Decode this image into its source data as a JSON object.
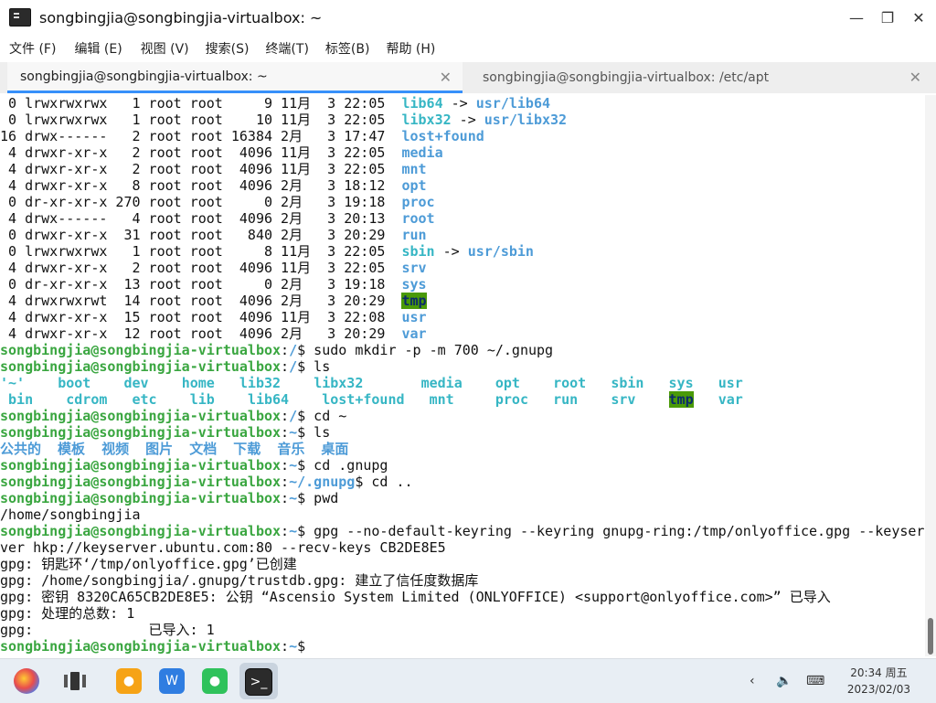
{
  "window": {
    "title": "songbingjia@songbingjia-virtualbox: ~"
  },
  "menu": [
    "文件 (F)",
    "编辑 (E)",
    "视图 (V)",
    "搜索(S)",
    "终端(T)",
    "标签(B)",
    "帮助 (H)"
  ],
  "tabs": [
    {
      "label": "songbingjia@songbingjia-virtualbox: ~"
    },
    {
      "label": "songbingjia@songbingjia-virtualbox: /etc/apt"
    }
  ],
  "terminal": {
    "lines": [
      [
        [
          " 0 lrwxrwxrwx   1 root root     9 11月  3 22:05  ",
          ""
        ],
        [
          "lib64",
          "cyan"
        ],
        [
          " -> ",
          ""
        ],
        [
          "usr/lib64",
          "blue"
        ]
      ],
      [
        [
          " 0 lrwxrwxrwx   1 root root    10 11月  3 22:05  ",
          ""
        ],
        [
          "libx32",
          "cyan"
        ],
        [
          " -> ",
          ""
        ],
        [
          "usr/libx32",
          "blue"
        ]
      ],
      [
        [
          "16 drwx------   2 root root 16384 2月   3 17:47  ",
          ""
        ],
        [
          "lost+found",
          "blue"
        ]
      ],
      [
        [
          " 4 drwxr-xr-x   2 root root  4096 11月  3 22:05  ",
          ""
        ],
        [
          "media",
          "blue"
        ]
      ],
      [
        [
          " 4 drwxr-xr-x   2 root root  4096 11月  3 22:05  ",
          ""
        ],
        [
          "mnt",
          "blue"
        ]
      ],
      [
        [
          " 4 drwxr-xr-x   8 root root  4096 2月   3 18:12  ",
          ""
        ],
        [
          "opt",
          "blue"
        ]
      ],
      [
        [
          " 0 dr-xr-xr-x 270 root root     0 2月   3 19:18  ",
          ""
        ],
        [
          "proc",
          "blue"
        ]
      ],
      [
        [
          " 4 drwx------   4 root root  4096 2月   3 20:13  ",
          ""
        ],
        [
          "root",
          "blue"
        ]
      ],
      [
        [
          " 0 drwxr-xr-x  31 root root   840 2月   3 20:29  ",
          ""
        ],
        [
          "run",
          "blue"
        ]
      ],
      [
        [
          " 0 lrwxrwxrwx   1 root root     8 11月  3 22:05  ",
          ""
        ],
        [
          "sbin",
          "cyan"
        ],
        [
          " -> ",
          ""
        ],
        [
          "usr/sbin",
          "blue"
        ]
      ],
      [
        [
          " 4 drwxr-xr-x   2 root root  4096 11月  3 22:05  ",
          ""
        ],
        [
          "srv",
          "blue"
        ]
      ],
      [
        [
          " 0 dr-xr-xr-x  13 root root     0 2月   3 19:18  ",
          ""
        ],
        [
          "sys",
          "blue"
        ]
      ],
      [
        [
          " 4 drwxrwxrwt  14 root root  4096 2月   3 20:29  ",
          ""
        ],
        [
          "tmp",
          "hl"
        ]
      ],
      [
        [
          " 4 drwxr-xr-x  15 root root  4096 11月  3 22:08  ",
          ""
        ],
        [
          "usr",
          "blue"
        ]
      ],
      [
        [
          " 4 drwxr-xr-x  12 root root  4096 2月   3 20:29  ",
          ""
        ],
        [
          "var",
          "blue"
        ]
      ],
      [
        [
          "songbingjia@songbingjia-virtualbox",
          "green"
        ],
        [
          ":",
          ""
        ],
        [
          "/",
          "blue"
        ],
        [
          "$ sudo mkdir -p -m 700 ~/.gnupg",
          ""
        ]
      ],
      [
        [
          "songbingjia@songbingjia-virtualbox",
          "green"
        ],
        [
          ":",
          ""
        ],
        [
          "/",
          "blue"
        ],
        [
          "$ ls",
          ""
        ]
      ],
      [
        [
          "'~'",
          "cyan"
        ],
        [
          "    ",
          ""
        ],
        [
          "boot",
          "cyan"
        ],
        [
          "    ",
          ""
        ],
        [
          "dev",
          "cyan"
        ],
        [
          "    ",
          ""
        ],
        [
          "home",
          "cyan"
        ],
        [
          "   ",
          ""
        ],
        [
          "lib32",
          "cyan"
        ],
        [
          "    ",
          ""
        ],
        [
          "libx32",
          "cyan"
        ],
        [
          "       ",
          ""
        ],
        [
          "media",
          "cyan"
        ],
        [
          "    ",
          ""
        ],
        [
          "opt",
          "cyan"
        ],
        [
          "    ",
          ""
        ],
        [
          "root",
          "cyan"
        ],
        [
          "   ",
          ""
        ],
        [
          "sbin",
          "cyan"
        ],
        [
          "   ",
          ""
        ],
        [
          "sys",
          "cyan"
        ],
        [
          "   ",
          ""
        ],
        [
          "usr",
          "cyan"
        ]
      ],
      [
        [
          " ",
          ""
        ],
        [
          "bin",
          "cyan"
        ],
        [
          "    ",
          ""
        ],
        [
          "cdrom",
          "cyan"
        ],
        [
          "   ",
          ""
        ],
        [
          "etc",
          "cyan"
        ],
        [
          "    ",
          ""
        ],
        [
          "lib",
          "cyan"
        ],
        [
          "    ",
          ""
        ],
        [
          "lib64",
          "cyan"
        ],
        [
          "    ",
          ""
        ],
        [
          "lost+found",
          "cyan"
        ],
        [
          "   ",
          ""
        ],
        [
          "mnt",
          "cyan"
        ],
        [
          "     ",
          ""
        ],
        [
          "proc",
          "cyan"
        ],
        [
          "   ",
          ""
        ],
        [
          "run",
          "cyan"
        ],
        [
          "    ",
          ""
        ],
        [
          "srv",
          "cyan"
        ],
        [
          "    ",
          ""
        ],
        [
          "tmp",
          "hl"
        ],
        [
          "   ",
          ""
        ],
        [
          "var",
          "cyan"
        ]
      ],
      [
        [
          "songbingjia@songbingjia-virtualbox",
          "green"
        ],
        [
          ":",
          ""
        ],
        [
          "/",
          "blue"
        ],
        [
          "$ cd ~",
          ""
        ]
      ],
      [
        [
          "songbingjia@songbingjia-virtualbox",
          "green"
        ],
        [
          ":",
          ""
        ],
        [
          "~",
          "blue"
        ],
        [
          "$ ls",
          ""
        ]
      ],
      [
        [
          "公共的  模板  视频  图片  文档  下载  音乐  桌面",
          "blue"
        ]
      ],
      [
        [
          "songbingjia@songbingjia-virtualbox",
          "green"
        ],
        [
          ":",
          ""
        ],
        [
          "~",
          "blue"
        ],
        [
          "$ cd .gnupg",
          ""
        ]
      ],
      [
        [
          "songbingjia@songbingjia-virtualbox",
          "green"
        ],
        [
          ":",
          ""
        ],
        [
          "~/.gnupg",
          "blue"
        ],
        [
          "$ cd ..",
          ""
        ]
      ],
      [
        [
          "songbingjia@songbingjia-virtualbox",
          "green"
        ],
        [
          ":",
          ""
        ],
        [
          "~",
          "blue"
        ],
        [
          "$ pwd",
          ""
        ]
      ],
      [
        [
          "/home/songbingjia",
          ""
        ]
      ],
      [
        [
          "songbingjia@songbingjia-virtualbox",
          "green"
        ],
        [
          ":",
          ""
        ],
        [
          "~",
          "blue"
        ],
        [
          "$ gpg --no-default-keyring --keyring gnupg-ring:/tmp/onlyoffice.gpg --keyser",
          ""
        ]
      ],
      [
        [
          "ver hkp://keyserver.ubuntu.com:80 --recv-keys CB2DE8E5",
          ""
        ]
      ],
      [
        [
          "gpg: 钥匙环‘/tmp/onlyoffice.gpg’已创建",
          ""
        ]
      ],
      [
        [
          "gpg: /home/songbingjia/.gnupg/trustdb.gpg: 建立了信任度数据库",
          ""
        ]
      ],
      [
        [
          "gpg: 密钥 8320CA65CB2DE8E5: 公钥 “Ascensio System Limited (ONLYOFFICE) <support@onlyoffice.com>” 已导入",
          ""
        ]
      ],
      [
        [
          "gpg: 处理的总数: 1",
          ""
        ]
      ],
      [
        [
          "gpg:              已导入: 1",
          ""
        ]
      ],
      [
        [
          "songbingjia@songbingjia-virtualbox",
          "green"
        ],
        [
          ":",
          ""
        ],
        [
          "~",
          "blue"
        ],
        [
          "$ ",
          ""
        ]
      ]
    ]
  },
  "taskbar": {
    "icons": [
      "start-menu-icon",
      "multitask-icon",
      "file-manager-icon",
      "wps-office-icon",
      "wechat-icon",
      "terminal-icon"
    ],
    "time": "20:34 周五",
    "date": "2023/02/03"
  }
}
